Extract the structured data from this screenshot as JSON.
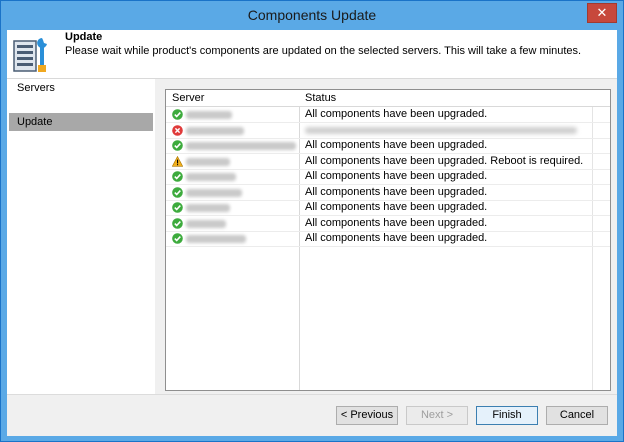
{
  "window": {
    "title": "Components Update",
    "close_glyph": "✕"
  },
  "header": {
    "title": "Update",
    "description": "Please wait while product's components are updated on the selected servers. This will take a few minutes."
  },
  "nav": {
    "items": [
      {
        "label": "Servers"
      },
      {
        "label": "Update"
      }
    ]
  },
  "grid": {
    "columns": {
      "server": "Server",
      "status": "Status"
    },
    "rows": [
      {
        "state": "success",
        "status": "All components have been upgraded."
      },
      {
        "state": "error",
        "status": ""
      },
      {
        "state": "success",
        "status": "All components have been upgraded."
      },
      {
        "state": "warning",
        "status": "All components have been upgraded. Reboot is required."
      },
      {
        "state": "success",
        "status": "All components have been upgraded."
      },
      {
        "state": "success",
        "status": "All components have been upgraded."
      },
      {
        "state": "success",
        "status": "All components have been upgraded."
      },
      {
        "state": "success",
        "status": "All components have been upgraded."
      },
      {
        "state": "success",
        "status": "All components have been upgraded."
      }
    ]
  },
  "buttons": {
    "previous": "< Previous",
    "next": "Next >",
    "finish": "Finish",
    "cancel": "Cancel"
  },
  "colors": {
    "success": "#3dab3d",
    "error": "#e03b3b",
    "warning": "#f2b01e",
    "titlebar": "#5aa9e6"
  }
}
